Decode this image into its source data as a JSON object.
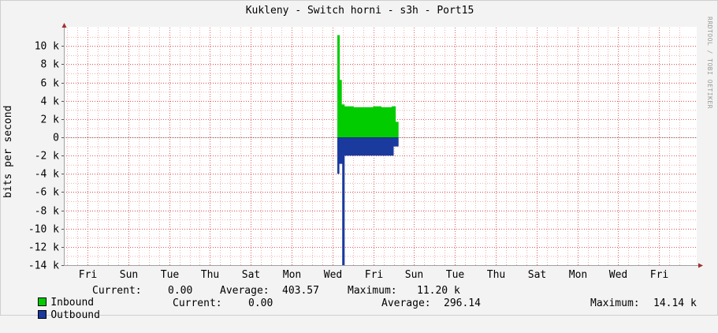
{
  "title": "Kukleny - Switch horni - s3h - Port15",
  "watermark": "RRDTOOL / TOBI OETIKER",
  "colors": {
    "inbound": "#00cc00",
    "outbound": "#0000ff",
    "outbound_display": "#1a3a9e",
    "grid_minor": "#f0b0b0",
    "grid_major": "#e06060",
    "axis": "#a0a0a0"
  },
  "chart_data": {
    "type": "area",
    "ylabel": "bits per second",
    "ylim": [
      -14000,
      11500
    ],
    "yticks": [
      {
        "value": 10000,
        "label": "10 k"
      },
      {
        "value": 8000,
        "label": "8 k"
      },
      {
        "value": 6000,
        "label": "6 k"
      },
      {
        "value": 4000,
        "label": "4 k"
      },
      {
        "value": 2000,
        "label": "2 k"
      },
      {
        "value": 0,
        "label": "0"
      },
      {
        "value": -2000,
        "label": "-2 k"
      },
      {
        "value": -4000,
        "label": "-4 k"
      },
      {
        "value": -6000,
        "label": "-6 k"
      },
      {
        "value": -8000,
        "label": "-8 k"
      },
      {
        "value": -10000,
        "label": "-10 k"
      },
      {
        "value": -12000,
        "label": "-12 k"
      },
      {
        "value": -14000,
        "label": "-14 k"
      }
    ],
    "xlim": [
      0,
      16
    ],
    "xticks": [
      {
        "value": 0,
        "label": "Fri"
      },
      {
        "value": 1,
        "label": "Sun"
      },
      {
        "value": 2,
        "label": "Tue"
      },
      {
        "value": 3,
        "label": "Thu"
      },
      {
        "value": 4,
        "label": "Sat"
      },
      {
        "value": 5,
        "label": "Mon"
      },
      {
        "value": 6,
        "label": "Wed"
      },
      {
        "value": 7,
        "label": "Fri"
      },
      {
        "value": 8,
        "label": "Sun"
      },
      {
        "value": 9,
        "label": "Tue"
      },
      {
        "value": 10,
        "label": "Thu"
      },
      {
        "value": 11,
        "label": "Sat"
      },
      {
        "value": 12,
        "label": "Mon"
      },
      {
        "value": 13,
        "label": "Wed"
      },
      {
        "value": 14,
        "label": "Fri"
      }
    ],
    "series": [
      {
        "name": "Inbound",
        "points": [
          [
            6.12,
            0
          ],
          [
            6.12,
            11200
          ],
          [
            6.18,
            11200
          ],
          [
            6.18,
            6300
          ],
          [
            6.23,
            6300
          ],
          [
            6.23,
            3600
          ],
          [
            6.3,
            3600
          ],
          [
            6.3,
            3400
          ],
          [
            6.52,
            3400
          ],
          [
            6.52,
            3300
          ],
          [
            7.0,
            3300
          ],
          [
            7.0,
            3400
          ],
          [
            7.2,
            3400
          ],
          [
            7.2,
            3300
          ],
          [
            7.45,
            3300
          ],
          [
            7.45,
            3400
          ],
          [
            7.55,
            3400
          ],
          [
            7.55,
            1700
          ],
          [
            7.62,
            1700
          ],
          [
            7.62,
            0
          ]
        ]
      },
      {
        "name": "Outbound",
        "points": [
          [
            6.12,
            0
          ],
          [
            6.12,
            -4000
          ],
          [
            6.17,
            -4000
          ],
          [
            6.17,
            -2900
          ],
          [
            6.24,
            -2900
          ],
          [
            6.24,
            -14000
          ],
          [
            6.3,
            -14000
          ],
          [
            6.3,
            -2000
          ],
          [
            7.5,
            -2000
          ],
          [
            7.5,
            -1000
          ],
          [
            7.62,
            -1000
          ],
          [
            7.62,
            0
          ]
        ]
      }
    ]
  },
  "legend": {
    "inbound": {
      "label": "Inbound",
      "current_label": "Current:",
      "current": "0.00",
      "average_label": "Average:",
      "average": "403.57",
      "maximum_label": "Maximum:",
      "maximum": "11.20 k"
    },
    "outbound": {
      "label": "Outbound",
      "current_label": "Current:",
      "current": "0.00",
      "average_label": "Average:",
      "average": "296.14",
      "maximum_label": "Maximum:",
      "maximum": "14.14 k"
    }
  }
}
